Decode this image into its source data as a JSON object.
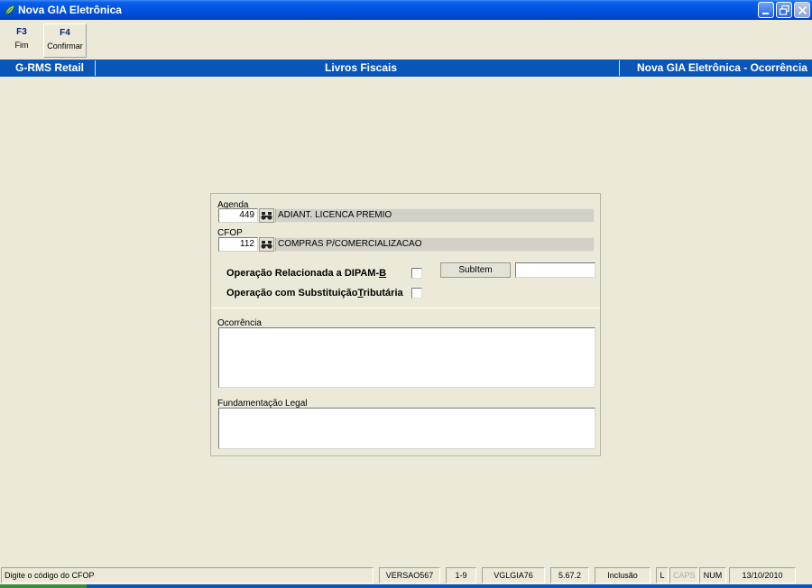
{
  "window": {
    "title": "Nova GIA Eletrônica",
    "icon": "app-leaf-icon",
    "controls": [
      "minimize-icon",
      "restore-icon",
      "close-icon"
    ]
  },
  "toolbar": {
    "buttons": [
      {
        "key": "F3",
        "label": "Fim"
      },
      {
        "key": "F4",
        "label": "Confirmar"
      }
    ]
  },
  "header": {
    "left": "G-RMS Retail",
    "center": "Livros Fiscais",
    "right": "Nova GIA Eletrônica - Ocorrência"
  },
  "form": {
    "agenda": {
      "label": "Agenda",
      "code": "449",
      "description": "ADIANT. LICENCA PREMIO",
      "lookup_icon": "binoculars-icon"
    },
    "cfop": {
      "label": "CFOP",
      "code": "112",
      "description": "COMPRAS P/COMERCIALIZACAO",
      "lookup_icon": "binoculars-icon"
    },
    "dipam": {
      "label_prefix": "Operação Relacionada a DIPAM-",
      "label_hotkey": "B",
      "checked": false
    },
    "substituicao": {
      "label_prefix": "Operação com Substituição",
      "label_hotkey": "T",
      "label_suffix": "ributária",
      "checked": false
    },
    "subitem": {
      "label": "SubItem",
      "value": ""
    },
    "ocorrencia": {
      "label": "Ocorrência",
      "value": ""
    },
    "fundamentacao": {
      "label": "Fundamentação Legal",
      "value": ""
    }
  },
  "statusbar": {
    "message": "Digite o código do CFOP",
    "version": "VERSAO567",
    "page": "1-9",
    "program": "VGLGIA76",
    "build": "5.67.2",
    "mode": "Inclusão",
    "l_indicator": "L",
    "caps": "CAPS",
    "num": "NUM",
    "date": "13/10/2010"
  },
  "colors": {
    "titlebar": "#0054e3",
    "header_band": "#0a56b8",
    "background": "#ece9d8"
  }
}
